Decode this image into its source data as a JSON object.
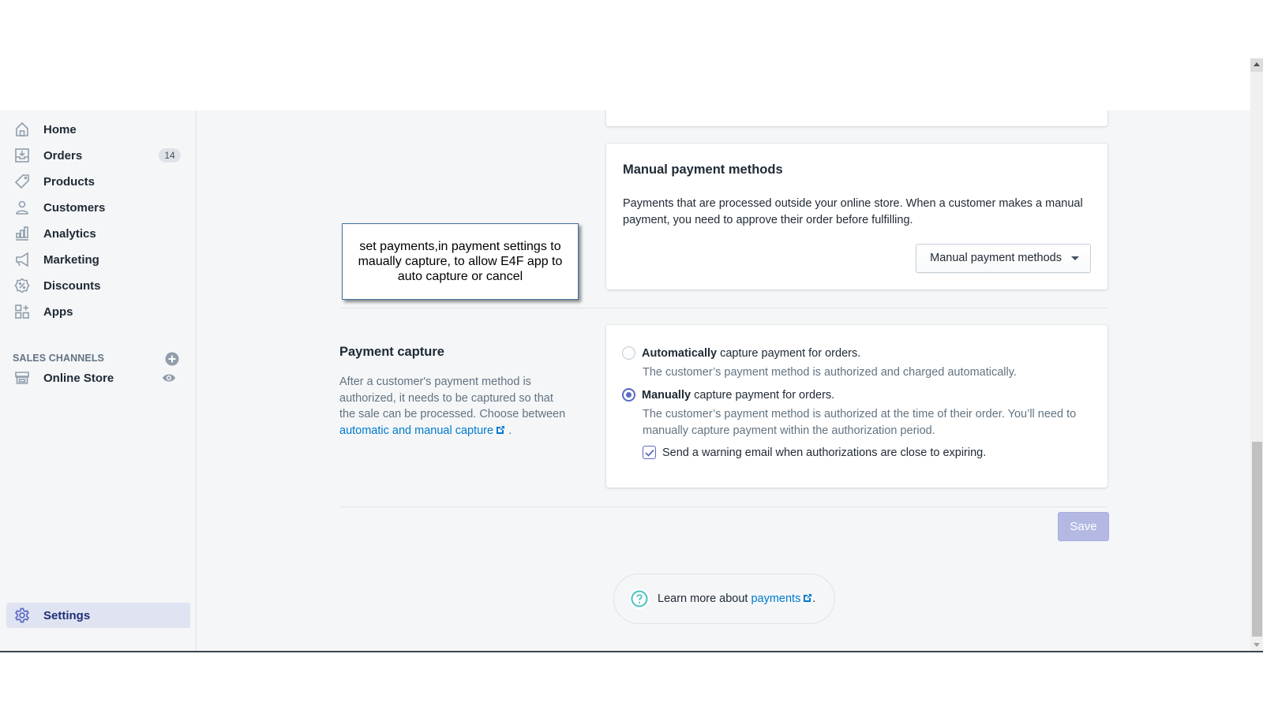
{
  "sidebar": {
    "items": [
      {
        "label": "Home",
        "icon": "home-icon"
      },
      {
        "label": "Orders",
        "icon": "orders-icon",
        "badge": "14"
      },
      {
        "label": "Products",
        "icon": "tag-icon"
      },
      {
        "label": "Customers",
        "icon": "person-icon"
      },
      {
        "label": "Analytics",
        "icon": "bar-chart-icon"
      },
      {
        "label": "Marketing",
        "icon": "megaphone-icon"
      },
      {
        "label": "Discounts",
        "icon": "discount-icon"
      },
      {
        "label": "Apps",
        "icon": "apps-icon"
      }
    ],
    "sales_channels": {
      "title": "SALES CHANNELS",
      "items": [
        {
          "label": "Online Store",
          "icon": "store-icon"
        }
      ]
    },
    "settings": {
      "label": "Settings",
      "icon": "gear-icon",
      "active": true
    }
  },
  "manual_payment": {
    "title": "Manual payment methods",
    "description": "Payments that are processed outside your online store. When a customer makes a manual payment, you need to approve their order before fulfilling.",
    "dropdown_label": "Manual payment methods"
  },
  "payment_capture": {
    "title": "Payment capture",
    "description": "After a customer's payment method is authorized, it needs to be captured so that the sale can be processed. Choose between ",
    "link_text": "automatic and manual capture",
    "link_suffix": " .",
    "options": [
      {
        "bold": "Automatically",
        "rest": " capture payment for orders.",
        "help": "The customer’s payment method is authorized and charged automatically.",
        "selected": false
      },
      {
        "bold": "Manually",
        "rest": " capture payment for orders.",
        "help": "The customer’s payment method is authorized at the time of their order. You’ll need to manually capture payment within the authorization period.",
        "selected": true
      }
    ],
    "warning_checkbox": {
      "label": "Send a warning email when authorizations are close to expiring.",
      "checked": true
    }
  },
  "save_label": "Save",
  "footer_help": {
    "prefix": "Learn more about ",
    "link_text": "payments",
    "suffix": " ."
  },
  "callout": {
    "text": "set payments,in payment settings to maually capture, to allow E4F app to auto capture or cancel"
  },
  "colors": {
    "accent": "#5c6ac4",
    "link": "#007ace",
    "save_disabled": "#b3b9e3",
    "background": "#f4f6f8",
    "help_icon": "#47c1bf"
  }
}
